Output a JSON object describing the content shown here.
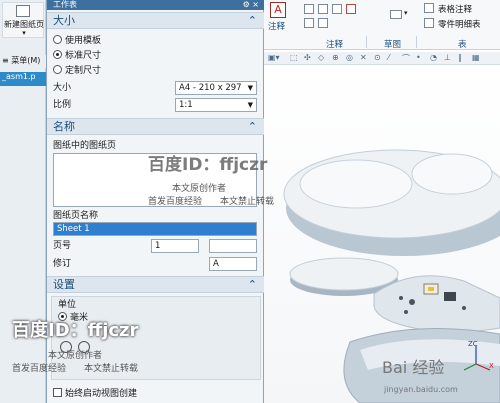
{
  "app_column": {
    "new_sheet_label": "新建图纸页",
    "menu_label": "菜单(M)",
    "part_tab": "_asm1.p"
  },
  "dialog": {
    "title": "工作表",
    "size_section": {
      "title": "大小",
      "options": [
        "使用模板",
        "标准尺寸",
        "定制尺寸"
      ],
      "selected_index": 1,
      "size_label": "大小",
      "size_value": "A4 - 210 x 297",
      "scale_label": "比例",
      "scale_value": "1:1"
    },
    "name_section": {
      "title": "名称",
      "sheets_in_drawing_label": "图纸中的图纸页",
      "sheet_name_label": "图纸页名称",
      "sheet_name_value": "Sheet 1",
      "page_number_label": "页号",
      "page_number_value": "1",
      "revision_label": "修订",
      "revision_value": "A"
    },
    "settings_section": {
      "title": "设置",
      "unit_label": "单位",
      "unit_value": "毫米",
      "always_start_view_label": "始终启动视图创建"
    }
  },
  "ribbon": {
    "note_label": "注释",
    "note_group": "注释",
    "sketch_group": "草图",
    "table_group": "表",
    "table_note_label": "表格注释",
    "parts_list_label": "零件明细表"
  },
  "watermarks": {
    "baidu_id_1": "百度ID：ffjczr",
    "baidu_id_2": "百度ID：ffjczr",
    "line_a": "本文原创作者",
    "line_b": "首发百度经验",
    "line_c": "本文禁止转载",
    "site": "jingyan.baidu.com"
  },
  "colors": {
    "accent": "#2f7fd1",
    "section_header": "#dde6ef",
    "title_bar": "#3d6f9f"
  }
}
